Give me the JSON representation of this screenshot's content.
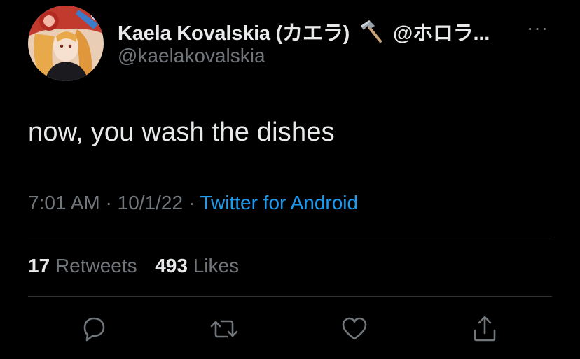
{
  "author": {
    "display_name": "Kaela Kovalskia (カエラ)",
    "name_suffix": "@ホロラ...",
    "handle": "@kaelakovalskia",
    "name_emoji": "hammer-icon"
  },
  "more_label": "···",
  "tweet": {
    "text": "now, you wash the dishes",
    "time": "7:01 AM",
    "separator": "·",
    "date": "10/1/22",
    "source": "Twitter for Android"
  },
  "stats": {
    "retweets_count": "17",
    "retweets_label": "Retweets",
    "likes_count": "493",
    "likes_label": "Likes"
  },
  "actions": [
    "reply-icon",
    "retweet-icon",
    "like-icon",
    "share-icon"
  ],
  "colors": {
    "background": "#000000",
    "primary_text": "#e7e9ea",
    "secondary_text": "#71767b",
    "link": "#1d9bf0",
    "divider": "#2f3336"
  }
}
